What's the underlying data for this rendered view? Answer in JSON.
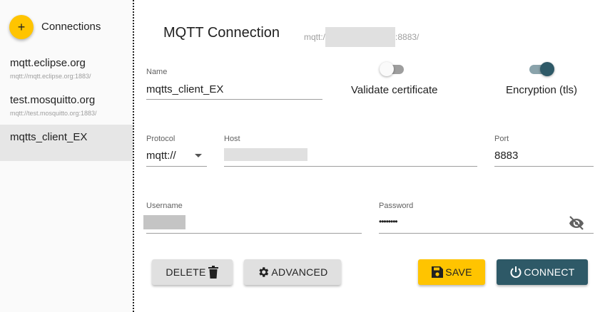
{
  "sidebar": {
    "title": "Connections",
    "add_icon": "+",
    "items": [
      {
        "name": "mqtt.eclipse.org",
        "url": "mqtt://mqtt.eclipse.org:1883/"
      },
      {
        "name": "test.mosquitto.org",
        "url": "mqtt://test.mosquitto.org:1883/"
      },
      {
        "name": "mqtts_client_EX",
        "url": ""
      }
    ]
  },
  "main": {
    "title": "MQTT Connection",
    "url_prefix": "mqtt:/",
    "url_suffix": ":8883/"
  },
  "form": {
    "name": {
      "label": "Name",
      "value": "mqtts_client_EX"
    },
    "validate_certificate": {
      "label": "Validate certificate",
      "enabled": false
    },
    "encryption": {
      "label": "Encryption (tls)",
      "enabled": true
    },
    "protocol": {
      "label": "Protocol",
      "value": "mqtt://"
    },
    "host": {
      "label": "Host",
      "value": ""
    },
    "port": {
      "label": "Port",
      "value": "8883"
    },
    "username": {
      "label": "Username",
      "value": ""
    },
    "password": {
      "label": "Password",
      "value": "••••••••"
    }
  },
  "buttons": {
    "delete": "DELETE",
    "advanced": "ADVANCED",
    "save": "SAVE",
    "connect": "CONNECT"
  },
  "colors": {
    "accent": "#ffc400",
    "primary": "#2e5967",
    "selected_bg": "#e6e6e6"
  },
  "icons": [
    "add-icon",
    "dropdown-arrow-icon",
    "visibility-off-icon",
    "trash-icon",
    "gear-icon",
    "save-icon",
    "power-icon"
  ]
}
